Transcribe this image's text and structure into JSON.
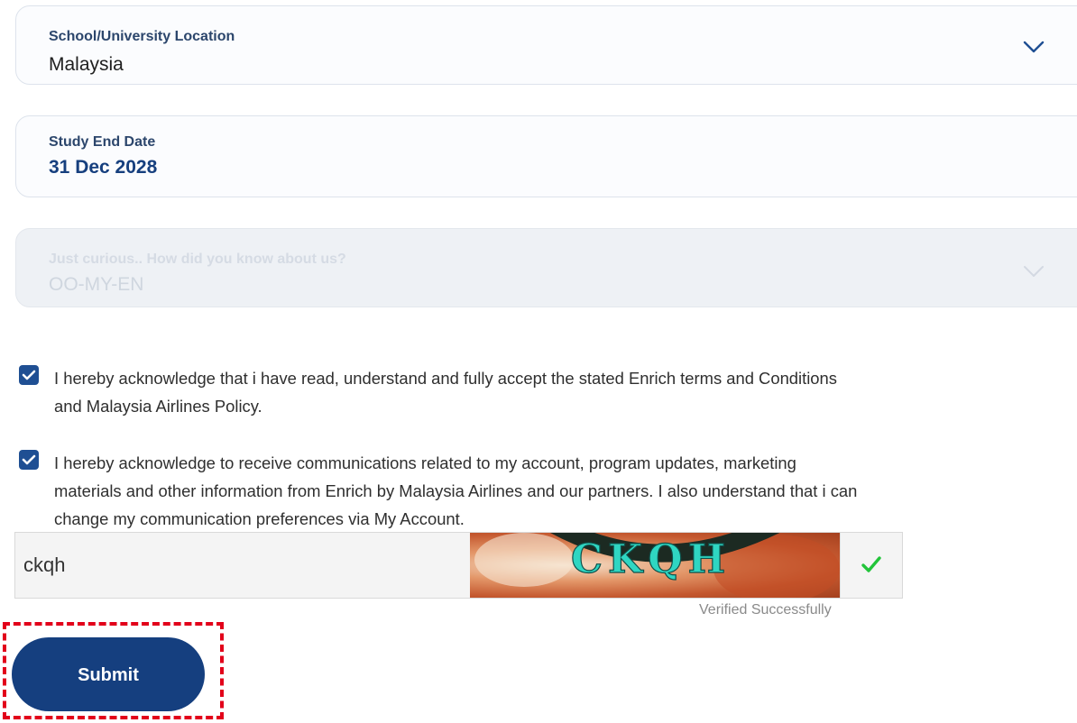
{
  "location_field": {
    "label": "School/University Location",
    "value": "Malaysia",
    "icon": "chevron-down-icon"
  },
  "end_date_field": {
    "label": "Study End Date",
    "value": "31 Dec 2028"
  },
  "source_field": {
    "label": "Just curious.. How did you know about us?",
    "value": "OO-MY-EN",
    "disabled": true,
    "icon": "chevron-down-icon"
  },
  "consents": {
    "terms": {
      "checked": true,
      "line1": "I hereby acknowledge that i have read, understand and fully accept the stated Enrich terms and Conditions",
      "line2": "and Malaysia Airlines Policy."
    },
    "communications": {
      "checked": true,
      "line1": "I hereby acknowledge to receive communications related to my account, program updates, marketing",
      "line2": "materials and other information from Enrich by Malaysia Airlines and our partners. I also understand that i can",
      "line3": "change my communication preferences via My Account."
    }
  },
  "captcha": {
    "input_value": "ckqh",
    "image_text": "CKQH",
    "status_icon": "checkmark-icon",
    "status_text": "Verified Successfully"
  },
  "submit": {
    "label": "Submit",
    "highlighted": true
  },
  "colors": {
    "primary": "#153f7f",
    "checkbox": "#1f4f93",
    "highlight": "#e2001a",
    "success": "#22c43a"
  }
}
